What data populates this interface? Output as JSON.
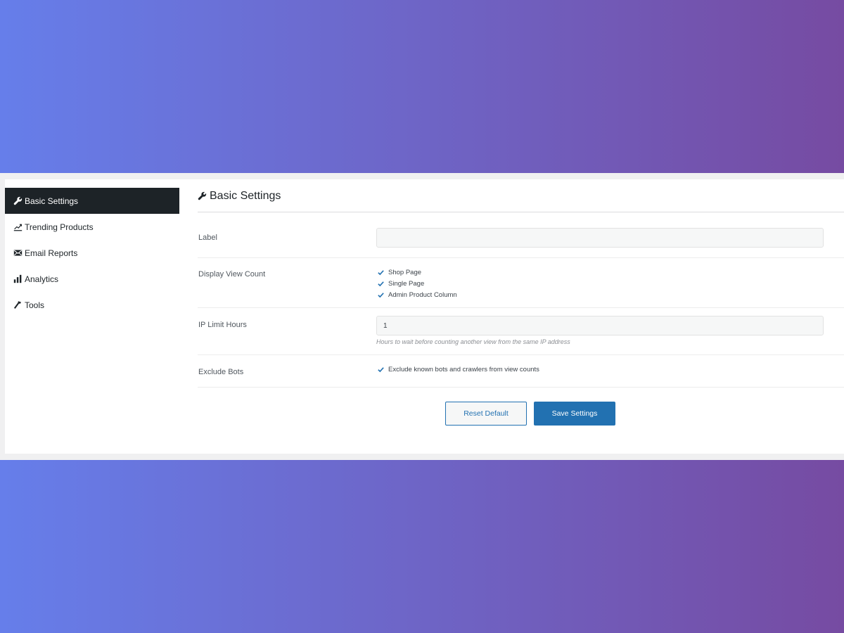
{
  "sidebar": {
    "items": [
      {
        "label": "Basic Settings",
        "icon": "wrench-icon"
      },
      {
        "label": "Trending Products",
        "icon": "trend-chart-icon"
      },
      {
        "label": "Email Reports",
        "icon": "envelope-icon"
      },
      {
        "label": "Analytics",
        "icon": "bar-chart-icon"
      },
      {
        "label": "Tools",
        "icon": "hammer-icon"
      }
    ]
  },
  "main": {
    "title": "Basic Settings",
    "label_row": {
      "label": "Label",
      "value": "",
      "placeholder": ""
    },
    "view_count_row": {
      "label": "Display View Count",
      "options": [
        {
          "label": "Shop Page",
          "checked": true
        },
        {
          "label": "Single Page",
          "checked": true
        },
        {
          "label": "Admin Product Column",
          "checked": true
        }
      ]
    },
    "ip_row": {
      "label": "IP Limit Hours",
      "value": "1",
      "hint": "Hours to wait before counting another view from the same IP address"
    },
    "bots_row": {
      "label": "Exclude Bots",
      "option": {
        "label": "Exclude known bots and crawlers from view counts",
        "checked": true
      }
    },
    "buttons": {
      "reset": "Reset Default",
      "save": "Save Settings"
    }
  },
  "colors": {
    "gradient_start": "#667eea",
    "gradient_end": "#764ba2",
    "active_nav": "#1d2327",
    "primary": "#2271b1"
  }
}
